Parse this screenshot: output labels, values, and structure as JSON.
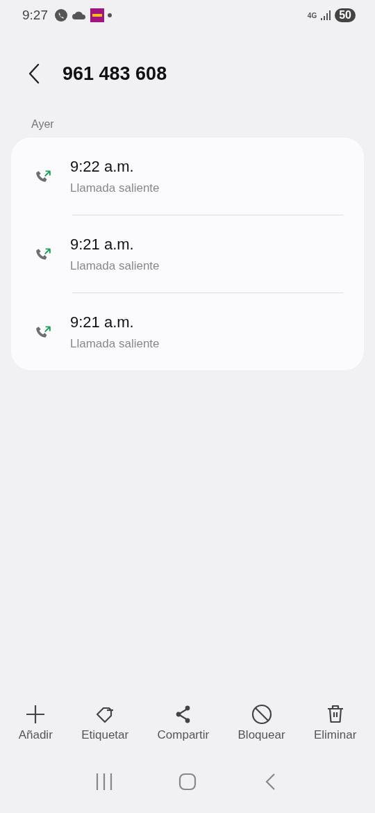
{
  "status_bar": {
    "time": "9:27",
    "network": "4G",
    "battery": "50"
  },
  "header": {
    "title": "961 483 608"
  },
  "section": {
    "label": "Ayer"
  },
  "calls": [
    {
      "kind": "outgoing",
      "time": "9:22 a.m.",
      "type": "Llamada saliente"
    },
    {
      "kind": "outgoing",
      "time": "9:21 a.m.",
      "type": "Llamada saliente"
    },
    {
      "kind": "outgoing",
      "time": "9:21 a.m.",
      "type": "Llamada saliente"
    }
  ],
  "actions": [
    {
      "kind": "add",
      "label": "Añadir"
    },
    {
      "kind": "tag",
      "label": "Etiquetar"
    },
    {
      "kind": "share",
      "label": "Compartir"
    },
    {
      "kind": "block",
      "label": "Bloquear"
    },
    {
      "kind": "delete",
      "label": "Eliminar"
    }
  ]
}
